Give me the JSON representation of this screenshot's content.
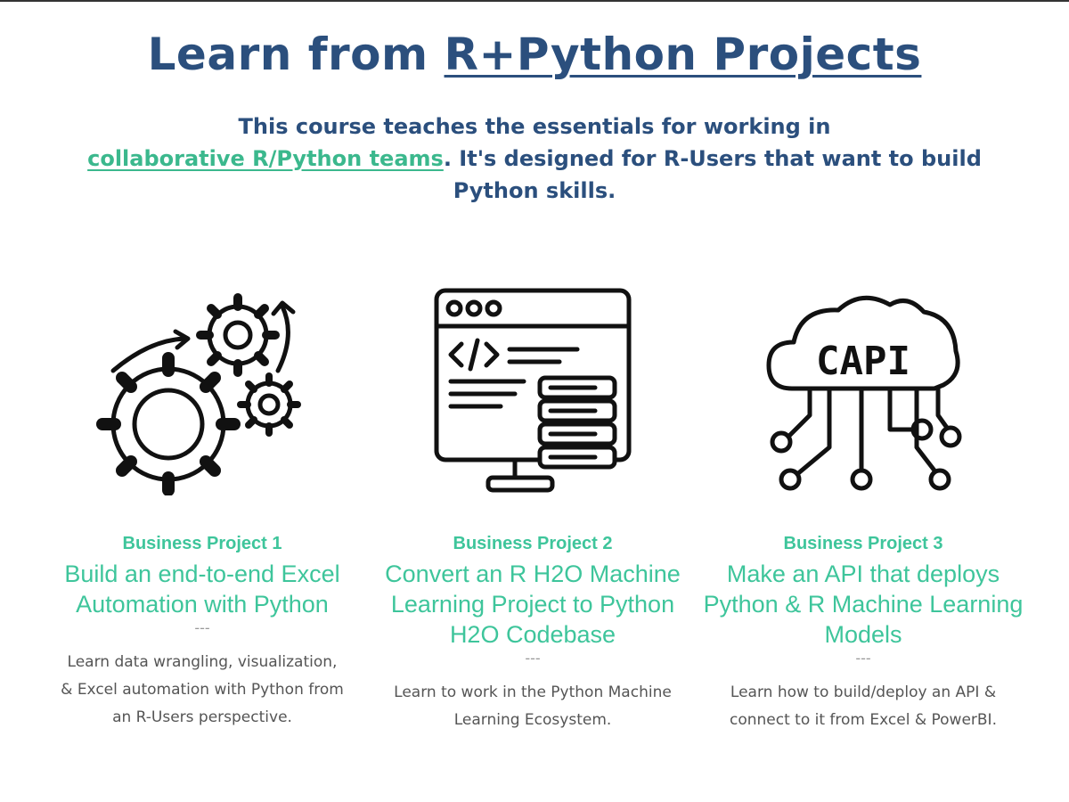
{
  "header": {
    "title_prefix": "Learn from ",
    "title_link": "R+Python Projects",
    "subtitle_pre": "This course teaches the essentials for working in",
    "subtitle_link": "collaborative R/Python teams",
    "subtitle_post": ". It's designed for R-Users that want to build Python skills."
  },
  "projects": [
    {
      "icon": "gears-automation-icon",
      "kicker": "Business Project 1",
      "headline": "Build an end-to-end Excel Automation with Python",
      "separator": "---",
      "description": "Learn data wrangling, visualization, & Excel automation with Python from an R-Users perspective."
    },
    {
      "icon": "code-server-monitor-icon",
      "kicker": "Business Project 2",
      "headline": "Convert an R H2O Machine Learning Project to Python H2O Codebase",
      "separator": "---",
      "description": "Learn to work in the Python Machine Learning Ecosystem."
    },
    {
      "icon": "api-cloud-icon",
      "kicker": "Business Project 3",
      "headline": "Make an API that deploys Python & R Machine Learning Models",
      "separator": "---",
      "description": "Learn how to build/deploy an API & connect to it from Excel & PowerBI."
    }
  ],
  "colors": {
    "navy": "#2b4f7d",
    "accent_green": "#3ec59b",
    "body_text": "#555555"
  }
}
